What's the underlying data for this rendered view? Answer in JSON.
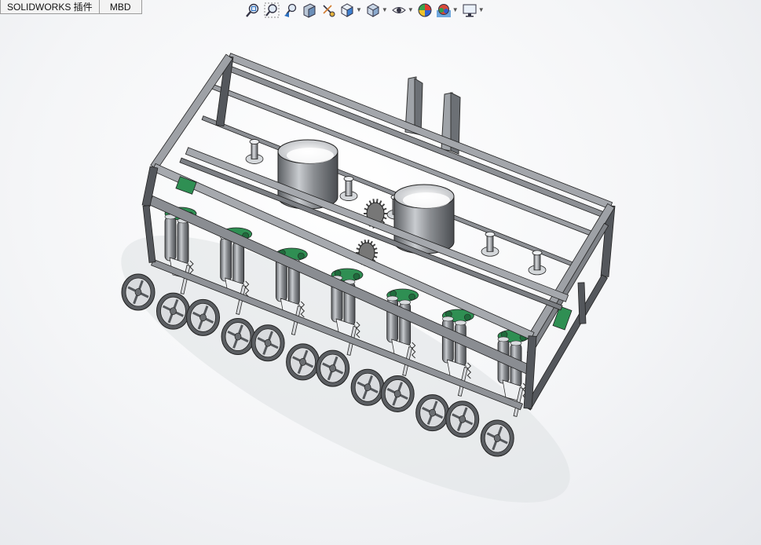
{
  "command_manager": {
    "tabs": [
      {
        "label": "SOLIDWORKS 插件"
      },
      {
        "label": "MBD"
      }
    ]
  },
  "heads_up_toolbar": {
    "buttons": [
      {
        "icon": "zoom-to-fit-icon",
        "dropdown": false
      },
      {
        "icon": "zoom-to-area-icon",
        "dropdown": false
      },
      {
        "icon": "previous-view-icon",
        "dropdown": false
      },
      {
        "icon": "section-view-icon",
        "dropdown": false
      },
      {
        "icon": "dynamic-annotation-views-icon",
        "dropdown": false
      },
      {
        "icon": "view-orientation-icon",
        "dropdown": true
      },
      {
        "icon": "display-style-icon",
        "dropdown": true
      },
      {
        "icon": "hide-show-items-icon",
        "dropdown": true
      },
      {
        "icon": "edit-appearance-icon",
        "dropdown": false
      },
      {
        "icon": "apply-scene-icon",
        "dropdown": true
      },
      {
        "icon": "view-settings-icon",
        "dropdown": true
      }
    ]
  },
  "model": {
    "name": "seed-drill-assembly",
    "colors": {
      "frame": "#8e9196",
      "frame_dark": "#54575c",
      "metal": "#c6c9cd",
      "green": "#2f8f53",
      "edge": "#222222"
    },
    "hoppers": 2,
    "seeder_units": 7,
    "wheels": 12
  }
}
